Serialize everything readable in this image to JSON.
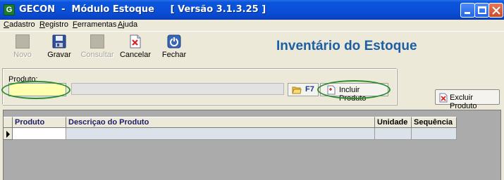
{
  "window": {
    "app_icon_letter": "G",
    "title": "GECON  -  Módulo Estoque     [ Versão 3.1.3.25 ]"
  },
  "menu": [
    {
      "label": "Cadastro",
      "hotkey_index": 0
    },
    {
      "label": "Registro",
      "hotkey_index": 0
    },
    {
      "label": "Ferramentas",
      "hotkey_index": 0
    },
    {
      "label": "Ajuda",
      "hotkey_index": 0
    }
  ],
  "toolbar": {
    "novo": "Novo",
    "gravar": "Gravar",
    "consultar": "Consultar",
    "cancelar": "Cancelar",
    "fechar": "Fechar"
  },
  "screen_title": "Inventário do Estoque",
  "form": {
    "produto_label": "Produto:",
    "produto_value": "",
    "descricao_value": "",
    "f7_label": "F7",
    "incluir_label": "Incluir Produto",
    "excluir_label": "Excluir Produto"
  },
  "grid": {
    "columns": [
      "Produto",
      "Descriçao do Produto",
      "Unidade",
      "Sequência"
    ],
    "rows": [
      [
        "",
        "",
        "",
        ""
      ]
    ]
  },
  "colors": {
    "title_blue": "#1c5fa4",
    "highlight_ellipse": "#2e8b2e",
    "input_yellow": "#ffffb0"
  }
}
